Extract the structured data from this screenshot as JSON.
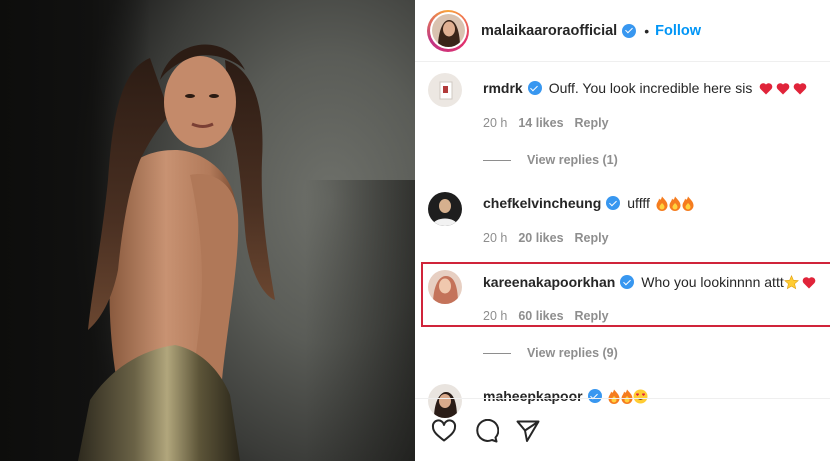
{
  "post": {
    "username": "malaikaaroraofficial",
    "separator": "•",
    "follow_label": "Follow"
  },
  "comments": [
    {
      "username": "rmdrk",
      "text": "Ouff. You look incredible here sis",
      "emoji": "red-heart x3",
      "time": "20 h",
      "likes": "14 likes",
      "reply": "Reply",
      "view_replies": "View replies (1)"
    },
    {
      "username": "chefkelvincheung",
      "text": "uffff",
      "emoji": "fire x3",
      "time": "20 h",
      "likes": "20 likes",
      "reply": "Reply"
    },
    {
      "username": "kareenakapoorkhan",
      "text": "Who you lookinnnn attt",
      "emoji": "star, red-heart",
      "time": "20 h",
      "likes": "60 likes",
      "reply": "Reply",
      "view_replies": "View replies (9)",
      "highlighted": true
    },
    {
      "username": "maheepkapoor",
      "emoji": "fire x2, heart-eyes"
    }
  ],
  "actions": {
    "like_icon": "heart-outline-icon",
    "comment_icon": "speech-bubble-icon",
    "share_icon": "paper-plane-icon"
  },
  "colors": {
    "follow_blue": "#0095f6",
    "verified_blue": "#3897f0",
    "highlight_red": "#d0243a",
    "meta_gray": "#8e8e8e"
  }
}
